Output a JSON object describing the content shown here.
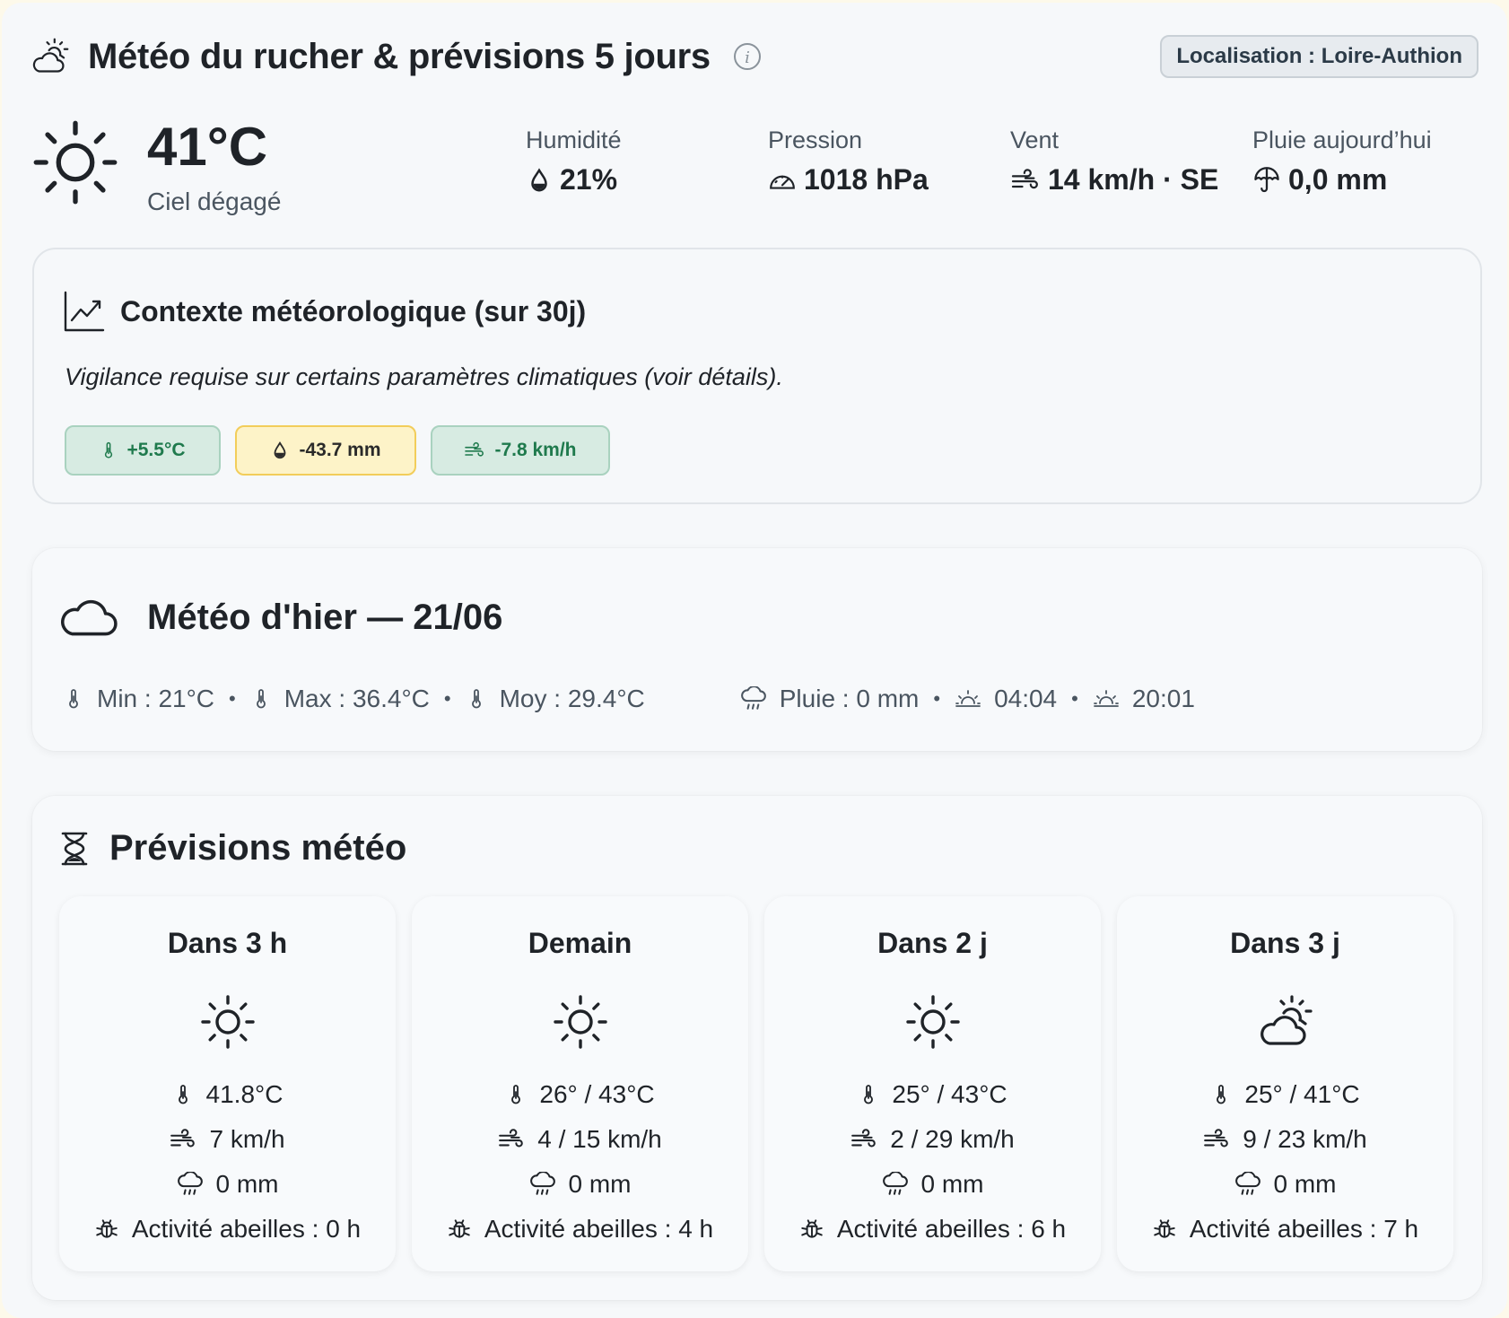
{
  "header": {
    "title": "Météo du rucher & prévisions 5 jours",
    "location": "Localisation : Loire-Authion"
  },
  "current": {
    "temperature": "41°C",
    "condition": "Ciel dégagé",
    "humidity": {
      "label": "Humidité",
      "value": "21%"
    },
    "pressure": {
      "label": "Pression",
      "value": "1018 hPa"
    },
    "wind": {
      "label": "Vent",
      "value": "14 km/h · SE"
    },
    "rain": {
      "label": "Pluie aujourd’hui",
      "value": "0,0 mm"
    }
  },
  "context": {
    "title": "Contexte météorologique (sur 30j)",
    "text": "Vigilance requise sur certains paramètres climatiques (voir détails).",
    "chips": [
      {
        "value": "+5.5°C",
        "status": "green",
        "icon": "thermometer-icon"
      },
      {
        "value": "-43.7 mm",
        "status": "yellow",
        "icon": "droplet-icon"
      },
      {
        "value": "-7.8 km/h",
        "status": "green",
        "icon": "wind-icon"
      }
    ]
  },
  "yesterday": {
    "title": "Météo d'hier — 21/06",
    "min": "Min : 21°C",
    "max": "Max : 36.4°C",
    "avg": "Moy : 29.4°C",
    "rain": "Pluie : 0 mm",
    "sunrise": "04:04",
    "sunset": "20:01"
  },
  "forecast": {
    "title": "Prévisions météo",
    "days": [
      {
        "label": "Dans 3 h",
        "icon": "sun-icon",
        "temp": "41.8°C",
        "wind": "7 km/h",
        "rain": "0 mm",
        "bees": "Activité abeilles : 0 h"
      },
      {
        "label": "Demain",
        "icon": "sun-icon",
        "temp": "26° / 43°C",
        "wind": "4 / 15 km/h",
        "rain": "0 mm",
        "bees": "Activité abeilles : 4 h"
      },
      {
        "label": "Dans 2 j",
        "icon": "sun-icon",
        "temp": "25° / 43°C",
        "wind": "2 / 29 km/h",
        "rain": "0 mm",
        "bees": "Activité abeilles : 6 h"
      },
      {
        "label": "Dans 3 j",
        "icon": "partly-cloudy-icon",
        "temp": "25° / 41°C",
        "wind": "9 / 23 km/h",
        "rain": "0 mm",
        "bees": "Activité abeilles : 7 h"
      }
    ]
  },
  "colors": {
    "chip_green_bg": "#d7ebe2",
    "chip_green_text": "#1f7a4d",
    "chip_yellow_bg": "#fdf3c8",
    "chip_yellow_border": "#f2cd5a"
  }
}
